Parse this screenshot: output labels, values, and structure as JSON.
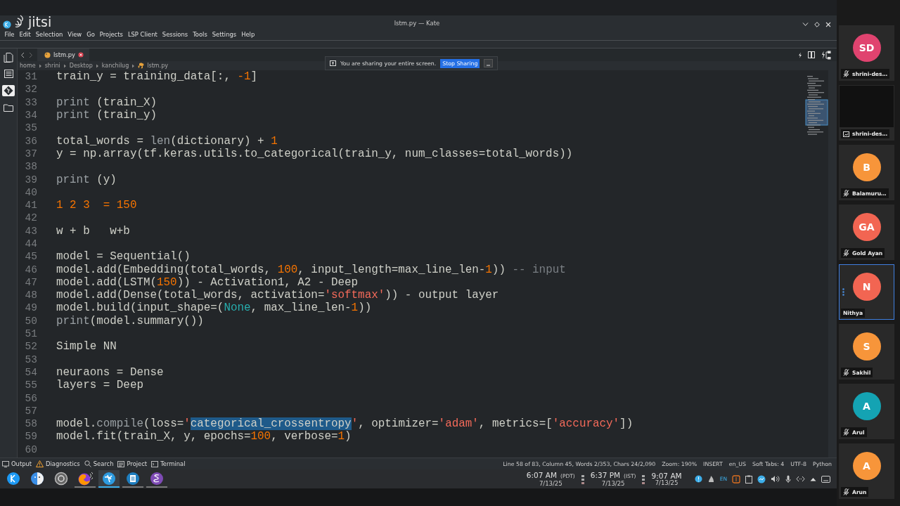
{
  "app": {
    "logo": "jitsi"
  },
  "window": {
    "title": "lstm.py — Kate"
  },
  "menu": [
    "File",
    "Edit",
    "Selection",
    "View",
    "Go",
    "Projects",
    "LSP Client",
    "Sessions",
    "Tools",
    "Settings",
    "Help"
  ],
  "tab": {
    "label": "lstm.py",
    "modified": true
  },
  "breadcrumb": [
    "home",
    "shrini",
    "Desktop",
    "kanchilug",
    "lstm.py"
  ],
  "share_banner": {
    "message": "You are sharing your entire screen.",
    "button": "Stop Sharing"
  },
  "editor": {
    "lines": [
      {
        "number": "31",
        "tokens": [
          {
            "kind": "text",
            "text": "train_y = training_data[:, "
          },
          {
            "kind": "number",
            "text": "-1"
          },
          {
            "kind": "text",
            "text": "]"
          }
        ]
      },
      {
        "number": "32"
      },
      {
        "number": "33",
        "tokens": [
          {
            "kind": "builtin",
            "text": "print"
          },
          {
            "kind": "text",
            "text": " (train_X)"
          }
        ]
      },
      {
        "number": "34",
        "tokens": [
          {
            "kind": "builtin",
            "text": "print"
          },
          {
            "kind": "text",
            "text": " (train_y)"
          }
        ]
      },
      {
        "number": "35"
      },
      {
        "number": "36",
        "tokens": [
          {
            "kind": "text",
            "text": "total_words = "
          },
          {
            "kind": "builtin",
            "text": "len"
          },
          {
            "kind": "text",
            "text": "(dictionary) + "
          },
          {
            "kind": "number",
            "text": "1"
          }
        ]
      },
      {
        "number": "37",
        "tokens": [
          {
            "kind": "text",
            "text": "y = np.array(tf.keras.utils.to_categorical(train_y, num_classes=total_words))"
          }
        ]
      },
      {
        "number": "38"
      },
      {
        "number": "39",
        "tokens": [
          {
            "kind": "builtin",
            "text": "print"
          },
          {
            "kind": "text",
            "text": " (y)"
          }
        ]
      },
      {
        "number": "40"
      },
      {
        "number": "41",
        "tokens": [
          {
            "kind": "number",
            "text": "1 2 3  = 150"
          }
        ]
      },
      {
        "number": "42"
      },
      {
        "number": "43",
        "tokens": [
          {
            "kind": "text",
            "text": "w + b   w+b"
          }
        ]
      },
      {
        "number": "44"
      },
      {
        "number": "45",
        "tokens": [
          {
            "kind": "text",
            "text": "model = Sequential()"
          }
        ]
      },
      {
        "number": "46",
        "tokens": [
          {
            "kind": "text",
            "text": "model.add(Embedding(total_words, "
          },
          {
            "kind": "number",
            "text": "100"
          },
          {
            "kind": "text",
            "text": ", input_length=max_line_len-"
          },
          {
            "kind": "number",
            "text": "1"
          },
          {
            "kind": "text",
            "text": ")) "
          },
          {
            "kind": "comment",
            "text": "-- input"
          }
        ]
      },
      {
        "number": "47",
        "tokens": [
          {
            "kind": "text",
            "text": "model.add(LSTM("
          },
          {
            "kind": "number",
            "text": "150"
          },
          {
            "kind": "text",
            "text": ")) - Activation1, A2 - Deep"
          }
        ]
      },
      {
        "number": "48",
        "tokens": [
          {
            "kind": "text",
            "text": "model.add(Dense(total_words, activation="
          },
          {
            "kind": "string",
            "text": "'softmax'"
          },
          {
            "kind": "text",
            "text": ")) - output layer"
          }
        ]
      },
      {
        "number": "49",
        "tokens": [
          {
            "kind": "text",
            "text": "model.build(input_shape=("
          },
          {
            "kind": "constant",
            "text": "None"
          },
          {
            "kind": "text",
            "text": ", max_line_len-"
          },
          {
            "kind": "number",
            "text": "1"
          },
          {
            "kind": "text",
            "text": "))"
          }
        ]
      },
      {
        "number": "50",
        "tokens": [
          {
            "kind": "builtin",
            "text": "print"
          },
          {
            "kind": "text",
            "text": "(model.summary())"
          }
        ]
      },
      {
        "number": "51"
      },
      {
        "number": "52",
        "tokens": [
          {
            "kind": "text",
            "text": "Simple NN"
          }
        ]
      },
      {
        "number": "53"
      },
      {
        "number": "54",
        "tokens": [
          {
            "kind": "text",
            "text": "neuraons = Dense"
          }
        ]
      },
      {
        "number": "55",
        "tokens": [
          {
            "kind": "text",
            "text": "layers = Deep"
          }
        ]
      },
      {
        "number": "56"
      },
      {
        "number": "57"
      },
      {
        "number": "58",
        "tokens": [
          {
            "kind": "text",
            "text": "model."
          },
          {
            "kind": "builtin",
            "text": "compile"
          },
          {
            "kind": "text",
            "text": "(loss="
          },
          {
            "kind": "string",
            "text": "'"
          },
          {
            "kind": "selected",
            "text": "categorical_crossentropy"
          },
          {
            "kind": "string",
            "text": "'"
          },
          {
            "kind": "text",
            "text": ", optimizer="
          },
          {
            "kind": "string",
            "text": "'adam'"
          },
          {
            "kind": "text",
            "text": ", metrics=["
          },
          {
            "kind": "string",
            "text": "'accuracy'"
          },
          {
            "kind": "text",
            "text": "])"
          }
        ]
      },
      {
        "number": "59",
        "tokens": [
          {
            "kind": "text",
            "text": "model.fit(train_X, y, epochs="
          },
          {
            "kind": "number",
            "text": "100"
          },
          {
            "kind": "text",
            "text": ", verbose="
          },
          {
            "kind": "number",
            "text": "1"
          },
          {
            "kind": "text",
            "text": ")"
          }
        ]
      },
      {
        "number": "60"
      }
    ]
  },
  "toolviews": [
    {
      "kind": "output",
      "label": "Output"
    },
    {
      "kind": "diagnostics",
      "label": "Diagnostics"
    },
    {
      "kind": "search",
      "label": "Search"
    },
    {
      "kind": "project",
      "label": "Project"
    },
    {
      "kind": "terminal",
      "label": "Terminal"
    }
  ],
  "status_bar": [
    "Line 58 of 83, Column 45, Words 2/353, Chars 24/2,090",
    "Zoom: 190%",
    "INSERT",
    "en_US",
    "Soft Tabs: 4",
    "UTF-8",
    "Python"
  ],
  "taskbar": {
    "apps": [
      {
        "kind": "launcher",
        "selected": false,
        "running": false
      },
      {
        "kind": "face",
        "selected": false,
        "running": false
      },
      {
        "kind": "gear",
        "selected": false,
        "running": false
      },
      {
        "kind": "fox",
        "selected": false,
        "running": true
      },
      {
        "kind": "bird",
        "selected": true,
        "running": true
      },
      {
        "kind": "document",
        "selected": false,
        "running": true
      },
      {
        "kind": "letter",
        "selected": false,
        "running": true
      }
    ],
    "clocks": [
      {
        "time": "6:07 AM",
        "zone": "(PDT)",
        "date": "7/13/25"
      },
      {
        "time": "6:37 PM",
        "zone": "(IST)",
        "date": "7/13/25"
      },
      {
        "time": "9:07 AM",
        "date": "7/13/25"
      }
    ],
    "language": "EN"
  },
  "participants": [
    {
      "kind": "avatar",
      "initials": "SD",
      "name": "shrini-des…",
      "color": "#e0436f",
      "muted": true,
      "selected": false
    },
    {
      "kind": "screen",
      "name": "shrini-des…",
      "selected": false
    },
    {
      "kind": "avatar",
      "initials": "B",
      "name": "Balamuru…",
      "color": "#f7953a",
      "muted": true,
      "selected": false
    },
    {
      "kind": "avatar",
      "initials": "GA",
      "name": "Gold Ayan",
      "color": "#f26552",
      "muted": true,
      "selected": false
    },
    {
      "kind": "avatar",
      "initials": "N",
      "name": "Nithya",
      "color": "#f26552",
      "muted": false,
      "selected": true
    },
    {
      "kind": "avatar",
      "initials": "S",
      "name": "Sakhil",
      "color": "#f7953a",
      "muted": true,
      "selected": false
    },
    {
      "kind": "avatar",
      "initials": "A",
      "name": "Arul",
      "color": "#14a3b3",
      "muted": true,
      "selected": false
    },
    {
      "kind": "avatar",
      "initials": "A",
      "name": "Arun",
      "color": "#f7953a",
      "muted": true,
      "selected": false
    }
  ]
}
